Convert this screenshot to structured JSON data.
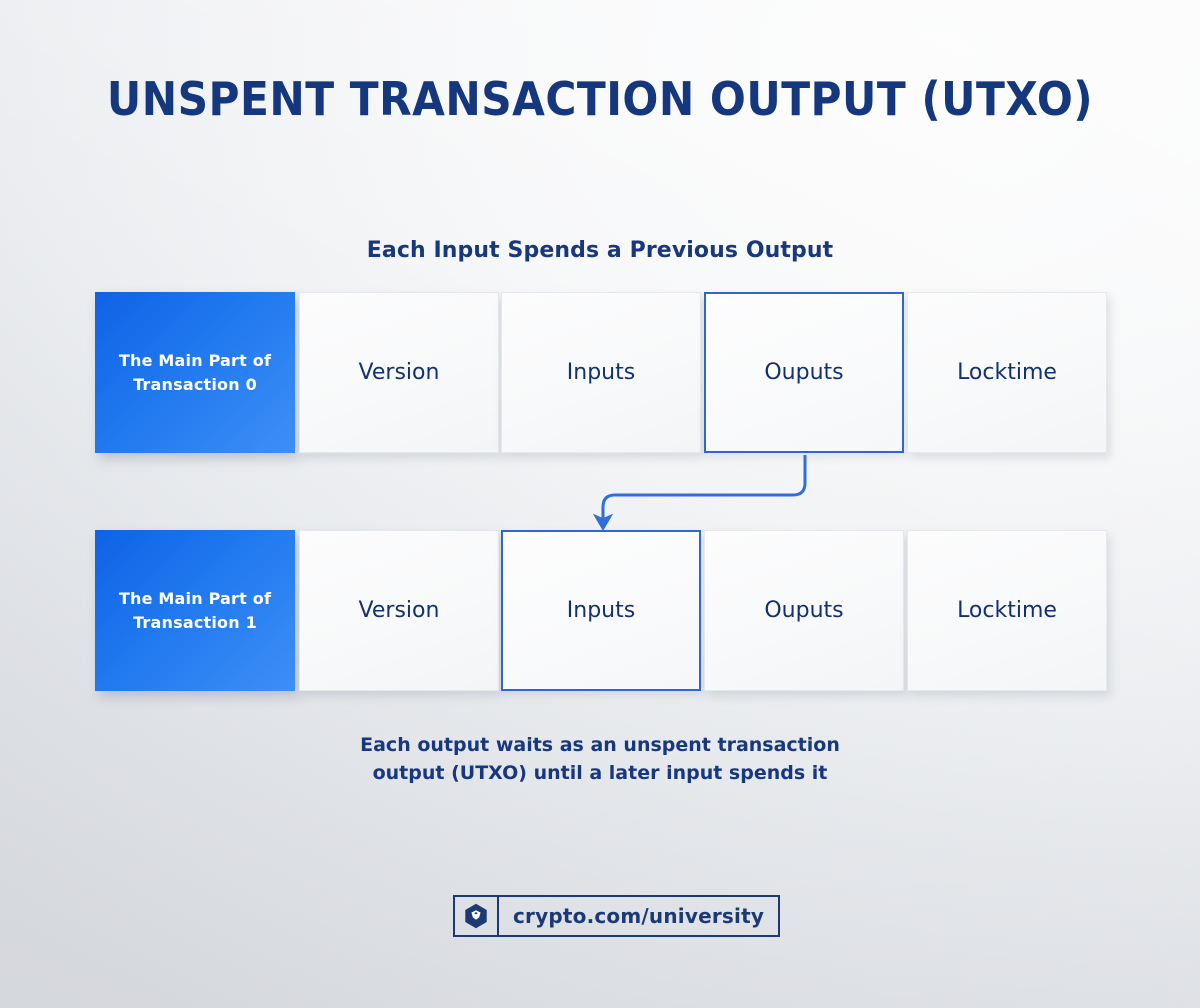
{
  "page": {
    "title": "UNSPENT TRANSACTION OUTPUT (UTXO)",
    "subtitle": "Each Input Spends a Previous Output",
    "caption_line_1": "Each output waits as an unspent transaction",
    "caption_line_2": "output (UTXO) until a later input spends it"
  },
  "colors": {
    "navy": "#14377d",
    "accent_blue": "#2f68c8",
    "blue_gradient_start": "#0f62e6",
    "blue_gradient_end": "#3e8ef6",
    "card_bg": "#f8f9fa",
    "background": "#f0f1f3"
  },
  "rows": [
    {
      "id": "transaction-0",
      "label_card": {
        "line_1": "The Main Part of",
        "line_2": "Transaction 0"
      },
      "cells": [
        {
          "label": "Version",
          "highlighted": false
        },
        {
          "label": "Inputs",
          "highlighted": false
        },
        {
          "label": "Ouputs",
          "highlighted": true
        },
        {
          "label": "Locktime",
          "highlighted": false
        }
      ]
    },
    {
      "id": "transaction-1",
      "label_card": {
        "line_1": "The Main Part of",
        "line_2": "Transaction 1"
      },
      "cells": [
        {
          "label": "Version",
          "highlighted": false
        },
        {
          "label": "Inputs",
          "highlighted": true
        },
        {
          "label": "Ouputs",
          "highlighted": false
        },
        {
          "label": "Locktime",
          "highlighted": false
        }
      ]
    }
  ],
  "connector": {
    "from": "transaction-0 Ouputs",
    "to": "transaction-1 Inputs",
    "color": "#2f6fdb"
  },
  "footer": {
    "logo_name": "crypto-com-logo",
    "url": "crypto.com/university"
  }
}
